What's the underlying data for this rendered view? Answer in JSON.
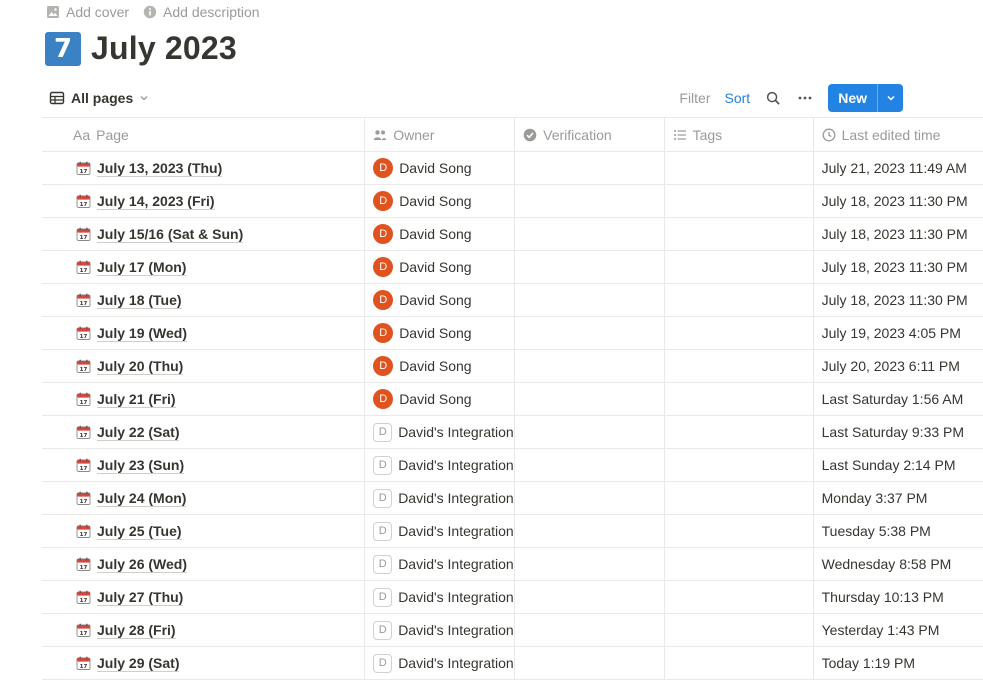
{
  "topbar": {
    "add_cover": "Add cover",
    "add_description": "Add description"
  },
  "page": {
    "icon_text": "7",
    "title": "July 2023"
  },
  "view": {
    "label": "All pages",
    "filter": "Filter",
    "sort": "Sort",
    "new": "New"
  },
  "columns": {
    "page": "Page",
    "page_prefix": "Aa",
    "owner": "Owner",
    "verification": "Verification",
    "tags": "Tags",
    "last_edited": "Last edited time"
  },
  "colors": {
    "accent": "#2383e2",
    "page_icon": "#3b82c4",
    "avatar": "#e0531f"
  },
  "rows": [
    {
      "page": "July 13, 2023 (Thu)",
      "owner": "David Song",
      "owner_type": "user",
      "avatar": "D",
      "time": "July 21, 2023 11:49 AM"
    },
    {
      "page": "July 14, 2023 (Fri)",
      "owner": "David Song",
      "owner_type": "user",
      "avatar": "D",
      "time": "July 18, 2023 11:30 PM"
    },
    {
      "page": "July 15/16 (Sat & Sun)",
      "owner": "David Song",
      "owner_type": "user",
      "avatar": "D",
      "time": "July 18, 2023 11:30 PM"
    },
    {
      "page": "July 17 (Mon)",
      "owner": "David Song",
      "owner_type": "user",
      "avatar": "D",
      "time": "July 18, 2023 11:30 PM"
    },
    {
      "page": "July 18 (Tue)",
      "owner": "David Song",
      "owner_type": "user",
      "avatar": "D",
      "time": "July 18, 2023 11:30 PM"
    },
    {
      "page": "July 19 (Wed)",
      "owner": "David Song",
      "owner_type": "user",
      "avatar": "D",
      "time": "July 19, 2023 4:05 PM"
    },
    {
      "page": "July 20 (Thu)",
      "owner": "David Song",
      "owner_type": "user",
      "avatar": "D",
      "time": "July 20, 2023 6:11 PM"
    },
    {
      "page": "July 21 (Fri)",
      "owner": "David Song",
      "owner_type": "user",
      "avatar": "D",
      "time": "Last Saturday 1:56 AM"
    },
    {
      "page": "July 22 (Sat)",
      "owner": "David's Integration",
      "owner_type": "integration",
      "avatar": "D",
      "time": "Last Saturday 9:33 PM"
    },
    {
      "page": "July 23 (Sun)",
      "owner": "David's Integration",
      "owner_type": "integration",
      "avatar": "D",
      "time": "Last Sunday 2:14 PM"
    },
    {
      "page": "July 24 (Mon)",
      "owner": "David's Integration",
      "owner_type": "integration",
      "avatar": "D",
      "time": "Monday 3:37 PM"
    },
    {
      "page": "July 25 (Tue)",
      "owner": "David's Integration",
      "owner_type": "integration",
      "avatar": "D",
      "time": "Tuesday 5:38 PM"
    },
    {
      "page": "July 26 (Wed)",
      "owner": "David's Integration",
      "owner_type": "integration",
      "avatar": "D",
      "time": "Wednesday 8:58 PM"
    },
    {
      "page": "July 27 (Thu)",
      "owner": "David's Integration",
      "owner_type": "integration",
      "avatar": "D",
      "time": "Thursday 10:13 PM"
    },
    {
      "page": "July 28 (Fri)",
      "owner": "David's Integration",
      "owner_type": "integration",
      "avatar": "D",
      "time": "Yesterday 1:43 PM"
    },
    {
      "page": "July 29 (Sat)",
      "owner": "David's Integration",
      "owner_type": "integration",
      "avatar": "D",
      "time": "Today 1:19 PM"
    }
  ]
}
